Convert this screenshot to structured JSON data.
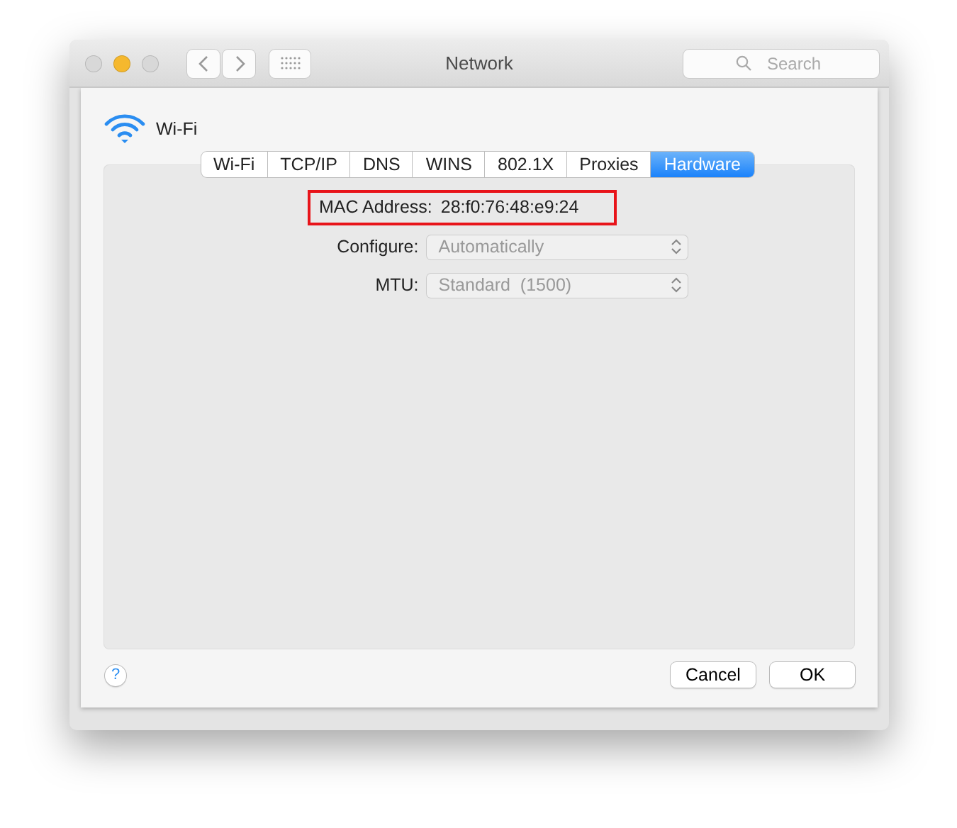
{
  "window": {
    "title": "Network",
    "traffic_lights": [
      {
        "color": "#d8d8d8"
      },
      {
        "color": "#f5b82e"
      },
      {
        "color": "#d8d8d8"
      }
    ],
    "search": {
      "placeholder": "Search"
    }
  },
  "interface": {
    "name": "Wi-Fi"
  },
  "tabs": [
    {
      "label": "Wi-Fi",
      "selected": false
    },
    {
      "label": "TCP/IP",
      "selected": false
    },
    {
      "label": "DNS",
      "selected": false
    },
    {
      "label": "WINS",
      "selected": false
    },
    {
      "label": "802.1X",
      "selected": false
    },
    {
      "label": "Proxies",
      "selected": false
    },
    {
      "label": "Hardware",
      "selected": true
    }
  ],
  "mac": {
    "label": "MAC Address:",
    "value": "28:f0:76:48:e9:24",
    "highlighted": true
  },
  "fields": [
    {
      "label": "Configure:",
      "value": "Automatically",
      "disabled": true
    },
    {
      "label": "MTU:",
      "value": "Standard  (1500)",
      "disabled": true
    }
  ],
  "help": "?",
  "buttons": [
    "Cancel",
    "OK"
  ]
}
